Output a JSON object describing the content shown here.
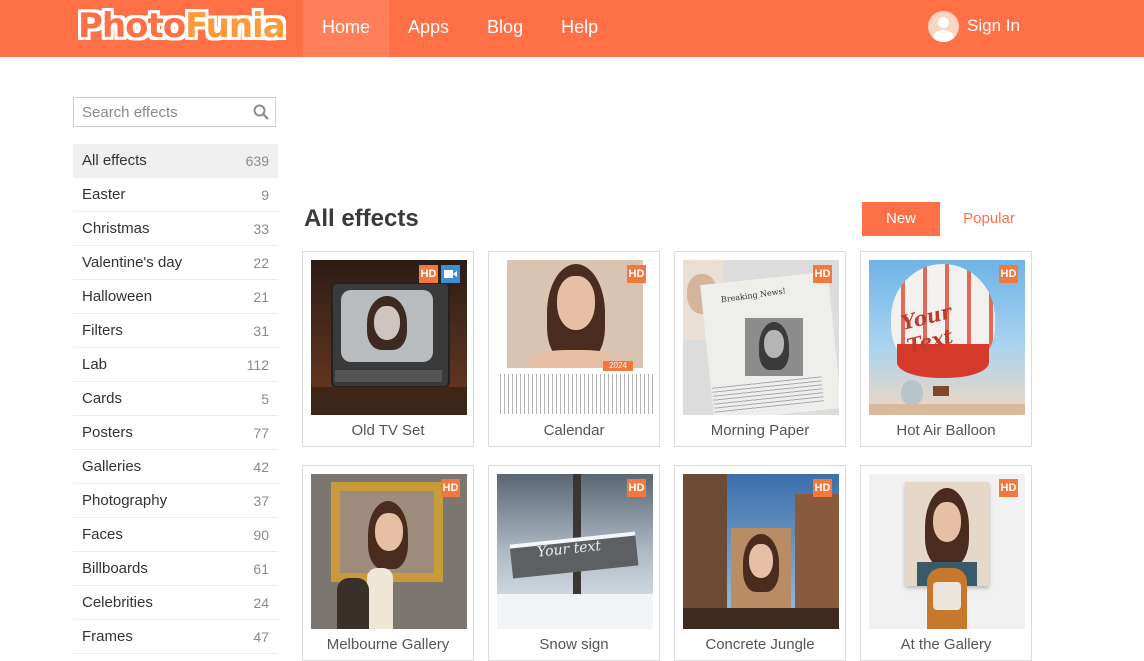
{
  "header": {
    "logo_part1": "Photo",
    "logo_part2": "Funia",
    "nav": [
      "Home",
      "Apps",
      "Blog",
      "Help"
    ],
    "sign_in": "Sign In"
  },
  "search": {
    "placeholder": "Search effects"
  },
  "categories": [
    {
      "label": "All effects",
      "count": "639"
    },
    {
      "label": "Easter",
      "count": "9"
    },
    {
      "label": "Christmas",
      "count": "33"
    },
    {
      "label": "Valentine's day",
      "count": "22"
    },
    {
      "label": "Halloween",
      "count": "21"
    },
    {
      "label": "Filters",
      "count": "31"
    },
    {
      "label": "Lab",
      "count": "112"
    },
    {
      "label": "Cards",
      "count": "5"
    },
    {
      "label": "Posters",
      "count": "77"
    },
    {
      "label": "Galleries",
      "count": "42"
    },
    {
      "label": "Photography",
      "count": "37"
    },
    {
      "label": "Faces",
      "count": "90"
    },
    {
      "label": "Billboards",
      "count": "61"
    },
    {
      "label": "Celebrities",
      "count": "24"
    },
    {
      "label": "Frames",
      "count": "47"
    }
  ],
  "main": {
    "title": "All effects",
    "sort_new": "New",
    "sort_popular": "Popular"
  },
  "effects": [
    {
      "label": "Old TV Set",
      "badge": "HD"
    },
    {
      "label": "Calendar",
      "badge": "HD",
      "year": "2024"
    },
    {
      "label": "Morning Paper",
      "badge": "HD",
      "paper_headline": "Breaking News!"
    },
    {
      "label": "Hot Air Balloon",
      "badge": "HD",
      "balloon_text": "Your Text"
    },
    {
      "label": "Melbourne Gallery",
      "badge": "HD"
    },
    {
      "label": "Snow sign",
      "badge": "HD",
      "sign_text": "Your text"
    },
    {
      "label": "Concrete Jungle",
      "badge": "HD"
    },
    {
      "label": "At the Gallery",
      "badge": "HD"
    }
  ],
  "colors": {
    "brand": "#ff7047",
    "hd_badge": "#f4773d",
    "video_badge": "#3a8fd6"
  }
}
